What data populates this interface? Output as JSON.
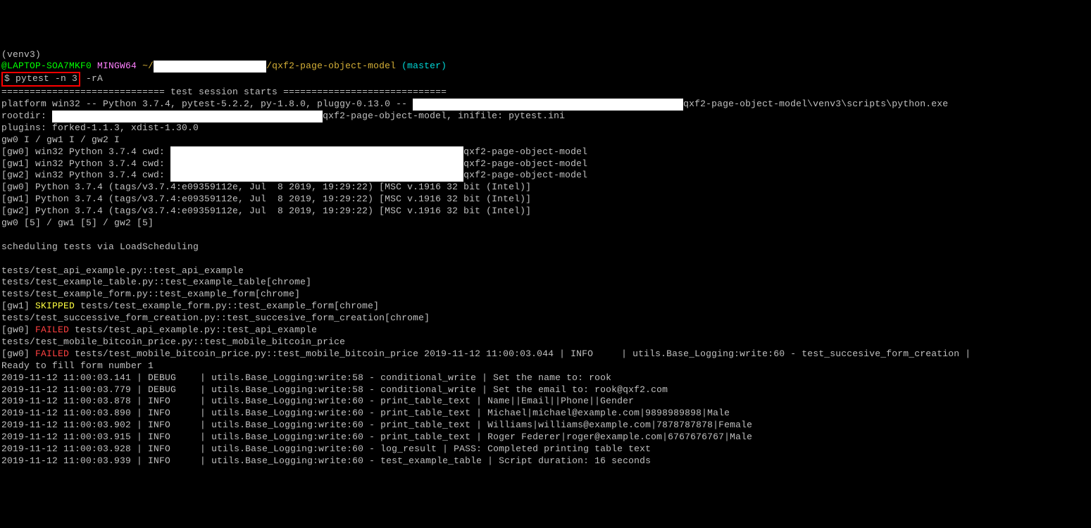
{
  "venv_line": "(venv3)",
  "prompt": {
    "user_host": "@LAPTOP-SOA7MKF0",
    "shell": "MINGW64",
    "home_prefix": "~/",
    "path_visible": "/qxf2-page-object-model",
    "branch": "(master)"
  },
  "command": {
    "dollar": "$ ",
    "cmd": "pytest -n 3",
    "flags": " -rA"
  },
  "session_header": "============================= test session starts =============================",
  "platform_line_before": "platform win32 -- Python 3.7.4, pytest-5.2.2, py-1.8.0, pluggy-0.13.0 -- ",
  "platform_line_after": "qxf2-page-object-model\\venv3\\scripts\\python.exe",
  "rootdir_text": "rootdir: ",
  "rootdir_after": "qxf2-page-object-model, inifile: pytest.ini",
  "plugins_line": "plugins: forked-1.1.3, xdist-1.30.0",
  "gw_init": "gw0 I / gw1 I / gw2 I",
  "workers": [
    {
      "prefix": "[gw0] win32 Python 3.7.4 cwd: ",
      "tail": "qxf2-page-object-model"
    },
    {
      "prefix": "[gw1] win32 Python 3.7.4 cwd: ",
      "tail": "qxf2-page-object-model"
    },
    {
      "prefix": "[gw2] win32 Python 3.7.4 cwd: ",
      "tail": "qxf2-page-object-model"
    }
  ],
  "python_versions": [
    "[gw0] Python 3.7.4 (tags/v3.7.4:e09359112e, Jul  8 2019, 19:29:22) [MSC v.1916 32 bit (Intel)]",
    "[gw1] Python 3.7.4 (tags/v3.7.4:e09359112e, Jul  8 2019, 19:29:22) [MSC v.1916 32 bit (Intel)]",
    "[gw2] Python 3.7.4 (tags/v3.7.4:e09359112e, Jul  8 2019, 19:29:22) [MSC v.1916 32 bit (Intel)]"
  ],
  "gw_counts": "gw0 [5] / gw1 [5] / gw2 [5]",
  "scheduling_line": "scheduling tests via LoadScheduling",
  "tests": {
    "t1": "tests/test_api_example.py::test_api_example",
    "t2": "tests/test_example_table.py::test_example_table[chrome]",
    "t3": "tests/test_example_form.py::test_example_form[chrome]",
    "skipped_worker": "[gw1] ",
    "skipped_label": "SKIPPED",
    "skipped_test": " tests/test_example_form.py::test_example_form[chrome]",
    "t4": "tests/test_successive_form_creation.py::test_succesive_form_creation[chrome]",
    "failed1_worker": "[gw0] ",
    "failed1_label": "FAILED",
    "failed1_test": " tests/test_api_example.py::test_api_example",
    "t5": "tests/test_mobile_bitcoin_price.py::test_mobile_bitcoin_price",
    "failed2_worker": "[gw0] ",
    "failed2_label": "FAILED",
    "failed2_test": " tests/test_mobile_bitcoin_price.py::test_mobile_bitcoin_price 2019-11-12 11:00:03.044 | INFO     | utils.Base_Logging:write:60 - test_succesive_form_creation |"
  },
  "ready_line": "Ready to fill form number 1",
  "log": [
    {
      "ts": "2019-11-12 11:00:03.141",
      "lvl": "DEBUG",
      "msg": "utils.Base_Logging:write:58 - conditional_write | Set the name to: rook"
    },
    {
      "ts": "2019-11-12 11:00:03.779",
      "lvl": "DEBUG",
      "msg": "utils.Base_Logging:write:58 - conditional_write | Set the email to: rook@qxf2.com"
    },
    {
      "ts": "2019-11-12 11:00:03.878",
      "lvl": "INFO",
      "msg": "utils.Base_Logging:write:60 - print_table_text | Name||Email||Phone||Gender"
    },
    {
      "ts": "2019-11-12 11:00:03.890",
      "lvl": "INFO",
      "msg": "utils.Base_Logging:write:60 - print_table_text | Michael|michael@example.com|9898989898|Male"
    },
    {
      "ts": "2019-11-12 11:00:03.902",
      "lvl": "INFO",
      "msg": "utils.Base_Logging:write:60 - print_table_text | Williams|williams@example.com|7878787878|Female"
    },
    {
      "ts": "2019-11-12 11:00:03.915",
      "lvl": "INFO",
      "msg": "utils.Base_Logging:write:60 - print_table_text | Roger Federer|roger@example.com|6767676767|Male"
    },
    {
      "ts": "2019-11-12 11:00:03.928",
      "lvl": "INFO",
      "msg": "utils.Base_Logging:write:60 - log_result | PASS: Completed printing table text"
    },
    {
      "ts": "2019-11-12 11:00:03.939",
      "lvl": "INFO",
      "msg": "utils.Base_Logging:write:60 - test_example_table | Script duration: 16 seconds"
    }
  ]
}
